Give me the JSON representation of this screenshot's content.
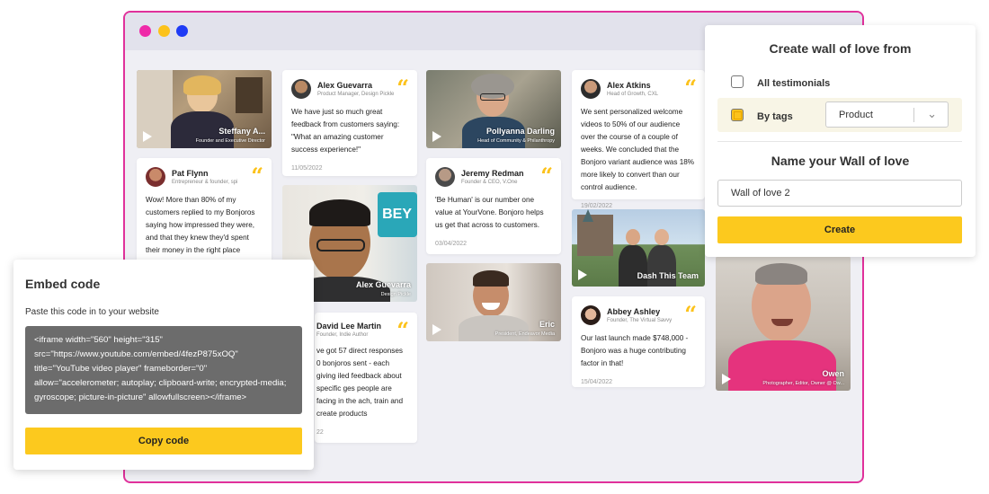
{
  "colors": {
    "accent": "#fcc91e",
    "frame": "#e0319b",
    "dot_pink": "#ef2aa8",
    "dot_yellow": "#fcc21b",
    "dot_blue": "#1f3bf5"
  },
  "videos": [
    {
      "name": "Steffany A...",
      "role": "Founder and Executive Director"
    },
    {
      "name": "Pollyanna Darling",
      "role": "Head of Community & Philanthropy"
    },
    {
      "name": "Alex Guevarra",
      "role": "Design Pickle"
    },
    {
      "name": "Eric",
      "role": "President, Endeavor Media"
    },
    {
      "name": "Dash This Team",
      "role": ""
    },
    {
      "name": "Owen",
      "role": "Photographer, Editor, Owner @ Ow..."
    }
  ],
  "cards": [
    {
      "name": "Alex Guevarra",
      "role": "Product Manager, Design Pickle",
      "text": "We have just so much great feedback from customers saying: \"What an amazing customer success experience!\"",
      "date": "11/05/2022"
    },
    {
      "name": "Pat Flynn",
      "role": "Entrepreneur & founder, spi",
      "text": "Wow! More than 80% of my customers replied to my Bonjoros saying how impressed they were, and that they knew they'd spent their money in the right place",
      "date": ""
    },
    {
      "name": "Jeremy Redman",
      "role": "Founder & CEO, V.One",
      "text": "'Be Human' is our number one value at YourVone. Bonjoro helps us get that across to customers.",
      "date": "03/04/2022"
    },
    {
      "name": "Alex Atkins",
      "role": "Head of Growth, CXL",
      "text": "We sent personalized welcome videos to 50% of our audience over the course of a couple of weeks. We concluded that the Bonjoro variant audience was 18% more likely to convert than our control audience.",
      "date": "19/02/2022"
    },
    {
      "name": "David Lee Martin",
      "role": "Founder, Indie Author",
      "text": "ve got 57 direct responses 0 bonjoros sent - each giving iled feedback about specific ges people are facing in the ach, train and create products",
      "date": "22"
    },
    {
      "name": "Abbey Ashley",
      "role": "Founder, The Virtual Savvy",
      "text": "Our last launch made $748,000 - Bonjoro was a huge contributing factor in that!",
      "date": "15/04/2022"
    }
  ],
  "panel": {
    "title": "Create wall of love from",
    "opt_all": "All testimonials",
    "opt_tags": "By tags",
    "select_value": "Product",
    "name_title": "Name your Wall of love",
    "name_value": "Wall of love 2",
    "create_label": "Create"
  },
  "embed": {
    "title": "Embed code",
    "subtitle": "Paste this code in to your website",
    "code": "<iframe width=\"560\" height=\"315\" src=\"https://www.youtube.com/embed/4fezP875xOQ\" title=\"YouTube video player\" frameborder=\"0\" allow=\"accelerometer; autoplay; clipboard-write; encrypted-media; gyroscope; picture-in-picture\" allowfullscreen></iframe>",
    "copy_label": "Copy code"
  }
}
